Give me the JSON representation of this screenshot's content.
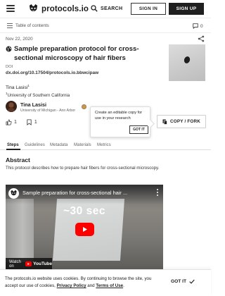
{
  "header": {
    "logo_text": "protocols.io",
    "search_label": "SEARCH",
    "signin_label": "SIGN IN",
    "signup_label": "SIGN UP"
  },
  "toolbar": {
    "toc_label": "Table of contents",
    "comment_count": "0"
  },
  "protocol": {
    "date": "Nov 22, 2020",
    "title": "Sample preparation protocol for cross-sectional microscopy of hair fibers",
    "doi_label": "DOI",
    "doi_value": "dx.doi.org/10.17504/protocols.io.bbwcipaw",
    "author": "Tina Lasisi",
    "author_sup": "1",
    "affiliation_sup": "1",
    "affiliation": "University of Southern California"
  },
  "author_card": {
    "name": "Tina Lasisi",
    "institution": "University of Michigan - Ann Arbor"
  },
  "stats": {
    "likes": "1",
    "bookmarks": "1"
  },
  "tooltip": {
    "text": "Create an editable copy for use in your research",
    "button_label": "GOT IT"
  },
  "copy_button": {
    "label": "COPY / FORK"
  },
  "tabs": [
    {
      "label": "Steps",
      "active": true
    },
    {
      "label": "Guidelines",
      "active": false
    },
    {
      "label": "Metadata",
      "active": false
    },
    {
      "label": "Materials",
      "active": false
    },
    {
      "label": "Metrics",
      "active": false
    }
  ],
  "abstract": {
    "heading": "Abstract",
    "text": "This protocol describes how to prepare hair fibers for cross-sectional microscopy."
  },
  "video": {
    "title": "Sample preparation for cross-sectional hair ...",
    "duration_overlay": "~30 sec",
    "watch_on": "Watch on",
    "youtube_label": "YouTube"
  },
  "cookie": {
    "text_before": "The protocols.io website uses cookies. By continuing to browse the site, you accept our use of cookies, ",
    "privacy_link": "Privacy Policy",
    "and_text": " and ",
    "terms_link": "Terms of Use",
    "period": ".",
    "got_it_label": "GOT IT"
  },
  "colors": {
    "accent_dark": "#1f1f1f",
    "youtube_red": "#ff0000",
    "badge_gold": "#c59a59"
  },
  "icons": {
    "menu": "menu-icon",
    "logo": "protocols-logo-icon",
    "search": "search-icon",
    "toc": "list-icon",
    "comments": "comment-icon",
    "share": "share-icon",
    "public": "globe-icon",
    "like": "thumbs-up-icon",
    "bookmark": "bookmark-icon",
    "copy": "copy-icon",
    "play": "play-icon",
    "check": "check-icon"
  }
}
